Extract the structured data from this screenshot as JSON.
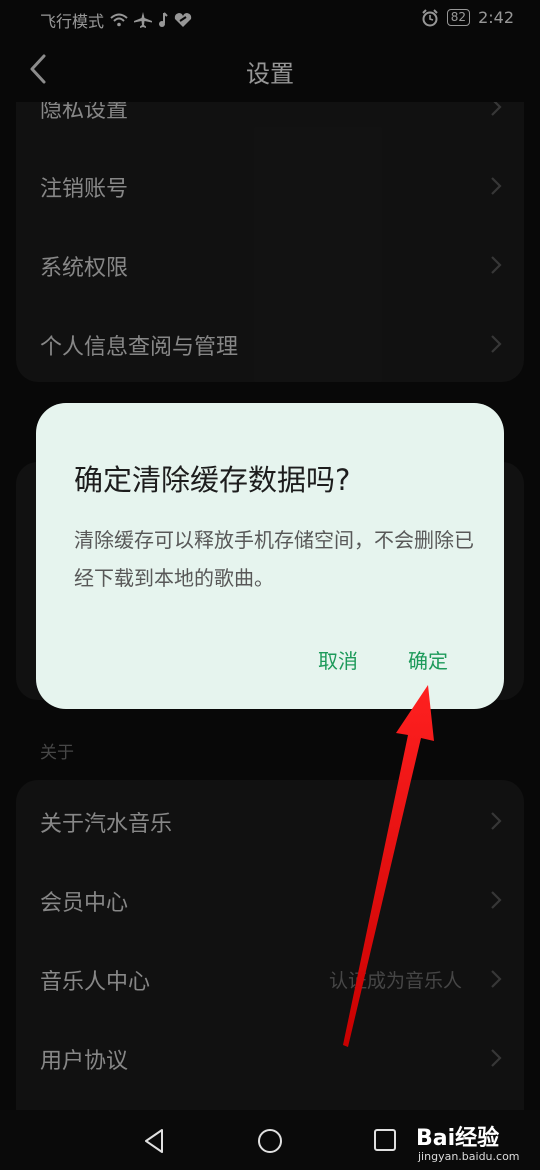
{
  "status_bar": {
    "left_text": "飞行模式",
    "battery": "82",
    "time": "2:42"
  },
  "header": {
    "title": "设置"
  },
  "settings_group_1": {
    "items": [
      {
        "label": "隐私设置"
      },
      {
        "label": "注销账号"
      },
      {
        "label": "系统权限"
      },
      {
        "label": "个人信息查阅与管理"
      }
    ]
  },
  "about_section": {
    "label": "关于",
    "items": [
      {
        "label": "关于汽水音乐",
        "extra": ""
      },
      {
        "label": "会员中心",
        "extra": ""
      },
      {
        "label": "音乐人中心",
        "extra": "认证成为音乐人"
      },
      {
        "label": "用户协议",
        "extra": ""
      }
    ]
  },
  "dialog": {
    "title": "确定清除缓存数据吗?",
    "message": "清除缓存可以释放手机存储空间，不会删除已经下载到本地的歌曲。",
    "cancel_label": "取消",
    "confirm_label": "确定"
  },
  "watermark": {
    "brand": "Bai经验",
    "sub": "jingyan.baidu.com"
  },
  "colors": {
    "accent": "#1d9a5a",
    "dialog_bg": "#e6f4ee",
    "annotation_arrow": "#ff1a1a"
  }
}
